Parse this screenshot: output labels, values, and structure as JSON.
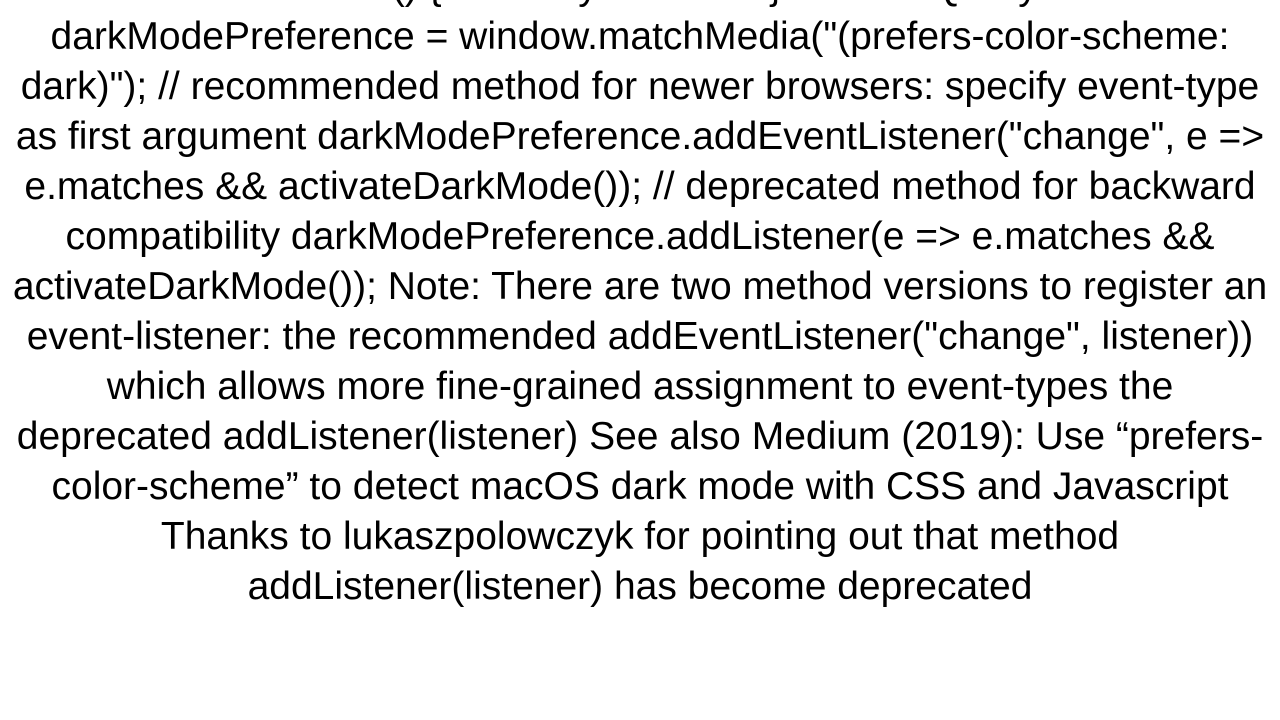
{
  "body": {
    "text": "activateDarkMode() {   // set style to dark }  // MediaQueryList const darkModePreference = window.matchMedia(\"(prefers-color-scheme: dark)\");  // recommended method for newer browsers: specify event-type as first argument darkModePreference.addEventListener(\"change\", e => e.matches && activateDarkMode());  // deprecated method for backward compatibility darkModePreference.addListener(e => e.matches && activateDarkMode());  Note: There are two method versions to register an event-listener:  the recommended addEventListener(\"change\", listener)) which allows more fine-grained assignment to event-types the deprecated addListener(listener)  See also  Medium (2019): Use “prefers-color-scheme” to detect macOS dark mode with CSS and Javascript   Thanks to lukaszpolowczyk for pointing out that method addListener(listener) has become deprecated"
  }
}
